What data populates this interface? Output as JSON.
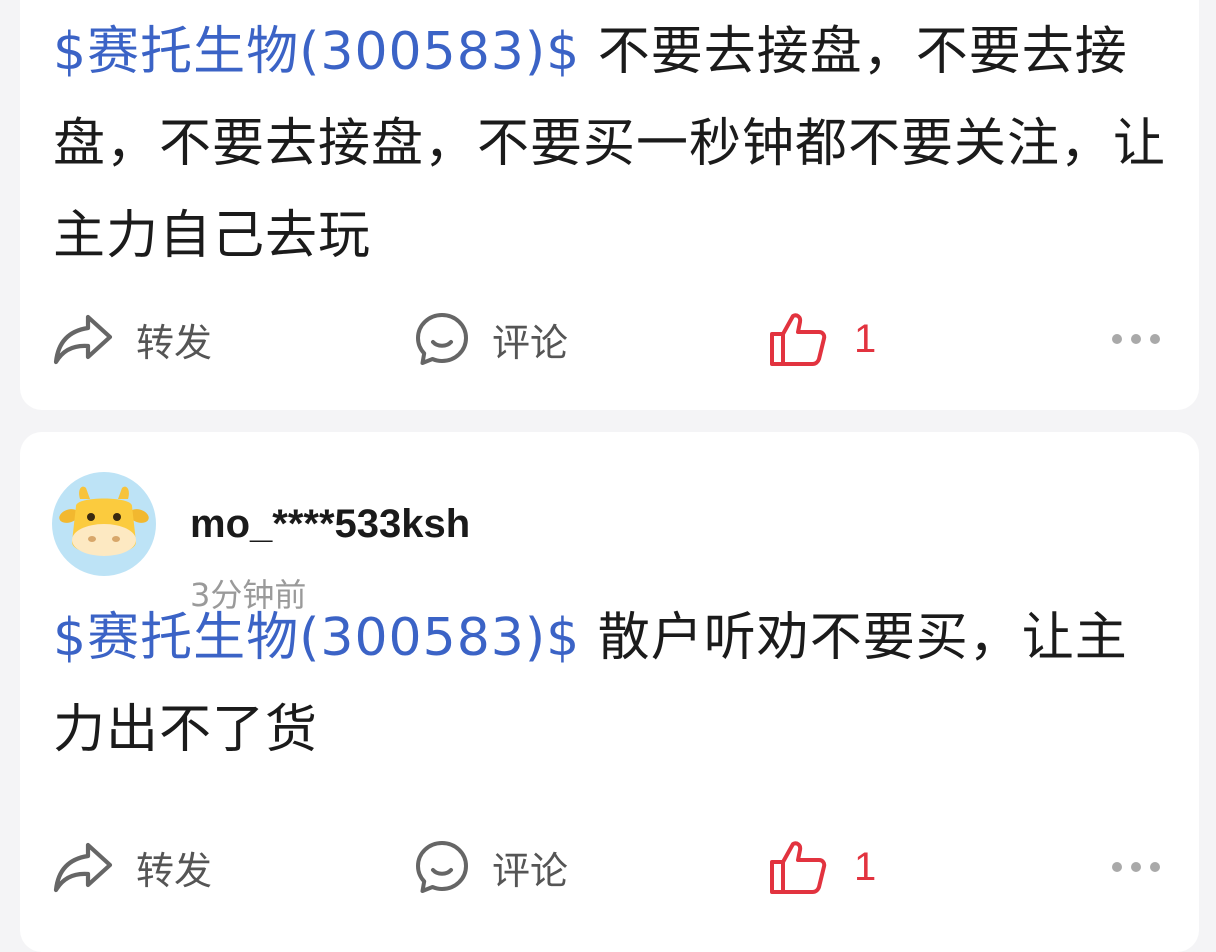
{
  "posts": [
    {
      "stock_tag": "$赛托生物(300583)$",
      "text": " 不要去接盘，不要去接盘，不要去接盘，不要买一秒钟都不要关注，让主力自己去玩",
      "actions": {
        "repost_label": "转发",
        "comment_label": "评论",
        "like_count": "1"
      }
    },
    {
      "author": {
        "username": "mo_****533ksh",
        "time": "3分钟前"
      },
      "stock_tag": "$赛托生物(300583)$",
      "text": " 散户听劝不要买，让主力出不了货",
      "actions": {
        "repost_label": "转发",
        "comment_label": "评论",
        "like_count": "1"
      }
    }
  ],
  "icons": {
    "repost": "share-arrow-icon",
    "comment": "comment-bubble-icon",
    "like": "thumbs-up-icon",
    "more": "more-dots-icon",
    "avatar": "cow-avatar"
  },
  "colors": {
    "stock_tag": "#3b63c6",
    "like_active": "#e2333f",
    "background": "#f4f4f6"
  }
}
